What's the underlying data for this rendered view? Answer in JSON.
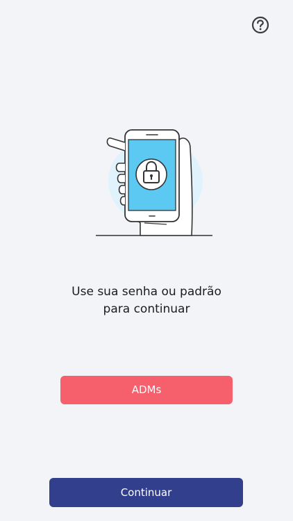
{
  "header": {
    "help_icon": "question-circle-icon"
  },
  "illustration": {
    "icon": "hand-holding-phone-with-lock-icon"
  },
  "message": {
    "line1": "Use sua senha ou padrão",
    "line2": "para continuar"
  },
  "buttons": {
    "adms_label": "ADMs",
    "continue_label": "Continuar"
  },
  "colors": {
    "background": "#f2f4f8",
    "adms_button": "#f5606c",
    "continue_button": "#323f8d",
    "phone_screen": "#5bc9f2"
  }
}
